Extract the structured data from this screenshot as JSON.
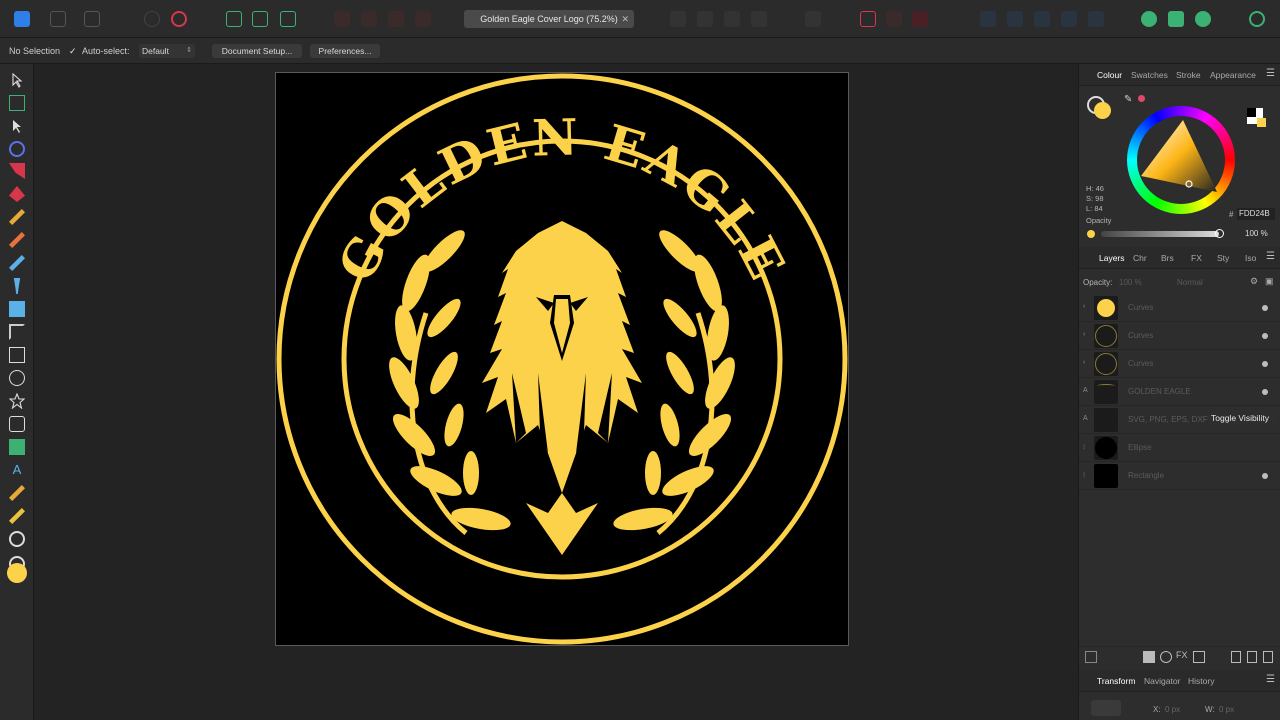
{
  "document": {
    "tab_title": "Golden Eagle Cover Logo (75.2%)",
    "close_glyph": "✕"
  },
  "context_toolbar": {
    "selection_status": "No Selection",
    "autoselect_label": "Auto-select:",
    "autoselect_value": "Default",
    "document_setup_label": "Document Setup...",
    "preferences_label": "Preferences..."
  },
  "artwork": {
    "title_text": "GOLDEN EAGLE",
    "gold_color": "#FDD24B"
  },
  "colour_panel": {
    "tabs": [
      "Colour",
      "Swatches",
      "Stroke",
      "Appearance"
    ],
    "h_label": "H: 46",
    "s_label": "S: 98",
    "l_label": "L: 84",
    "hex_prefix": "#",
    "hex_value": "FDD24B",
    "opacity_label": "Opacity",
    "opacity_value": "100 %"
  },
  "layers_panel": {
    "tabs": [
      "Layers",
      "Chr",
      "Brs",
      "FX",
      "Sty",
      "Iso"
    ],
    "opacity_label": "Opacity:",
    "opacity_value": "100 %",
    "blend_mode": "Normal",
    "layers": [
      {
        "name": "Curves"
      },
      {
        "name": "Curves"
      },
      {
        "name": "Curves"
      },
      {
        "name": "GOLDEN EAGLE"
      },
      {
        "name": "SVG, PNG, EPS, DXF"
      },
      {
        "name": "Ellipse"
      },
      {
        "name": "Rectangle"
      }
    ]
  },
  "tooltip": {
    "text": "Toggle Visibility"
  },
  "transform_panel": {
    "tabs": [
      "Transform",
      "Navigator",
      "History"
    ],
    "x_label": "X:",
    "x_value": "0 px",
    "w_label": "W:",
    "w_value": "0 px"
  },
  "colors": {
    "gold": "#FDD24B",
    "accent_blue": "#2F7FE8",
    "accent_red": "#D8364A",
    "accent_green": "#3BB273"
  }
}
